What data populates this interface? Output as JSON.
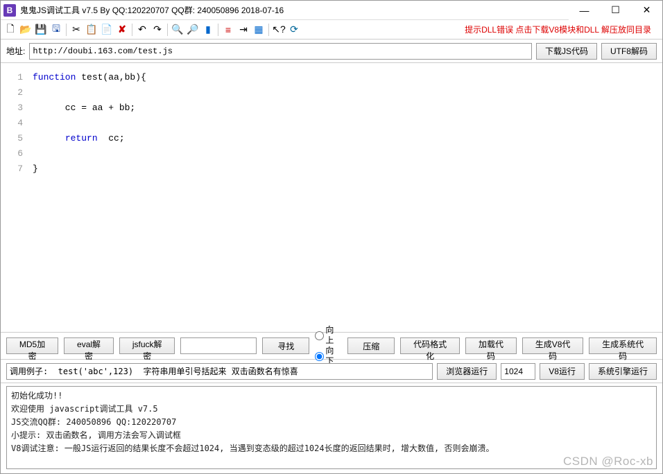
{
  "window": {
    "title": "鬼鬼JS调试工具 v7.5 By QQ:120220707  QQ群:  240050896  2018-07-16",
    "icon_letter": "B"
  },
  "toolbar": {
    "help_text": "提示DLL错误 点击下载V8模块和DLL 解压放同目录"
  },
  "address": {
    "label": "地址: ",
    "value": "http://doubi.163.com/test.js",
    "download_btn": "下载JS代码",
    "utf8_btn": "UTF8解码"
  },
  "editor": {
    "lines": [
      {
        "num": "1",
        "html": "<span class='kw'>function</span> test(aa,bb){"
      },
      {
        "num": "2",
        "html": ""
      },
      {
        "num": "3",
        "html": "      cc = aa + bb;"
      },
      {
        "num": "4",
        "html": ""
      },
      {
        "num": "5",
        "html": "      <span class='kw'>return</span>  cc;"
      },
      {
        "num": "6",
        "html": ""
      },
      {
        "num": "7",
        "html": "}"
      }
    ]
  },
  "mid": {
    "md5": "MD5加密",
    "eval": "eval解密",
    "jsfuck": "jsfuck解密",
    "find": "寻找",
    "up": "向上",
    "down": "向下",
    "compress": "压缩",
    "format": "代码格式化",
    "load": "加载代码",
    "genv8": "生成V8代码",
    "gensys": "生成系统代码"
  },
  "call": {
    "example": "调用例子:  test('abc',123)  字符串用单引号括起来 双击函数名有惊喜",
    "browser_run": "浏览器运行",
    "num": "1024",
    "v8_run": "V8运行",
    "sys_run": "系统引擎运行"
  },
  "log": {
    "l1": "初始化成功!!",
    "l2": "欢迎使用 javascript调试工具 v7.5",
    "l3": "JS交流QQ群: 240050896   QQ:120220707",
    "l4": "小提示: 双击函数名, 调用方法会写入调试框",
    "l5": "V8调试注意: 一般JS运行返回的结果长度不会超过1024, 当遇到变态级的超过1024长度的返回结果时, 增大数值, 否则会崩溃。"
  },
  "watermark": "CSDN @Roc-xb"
}
